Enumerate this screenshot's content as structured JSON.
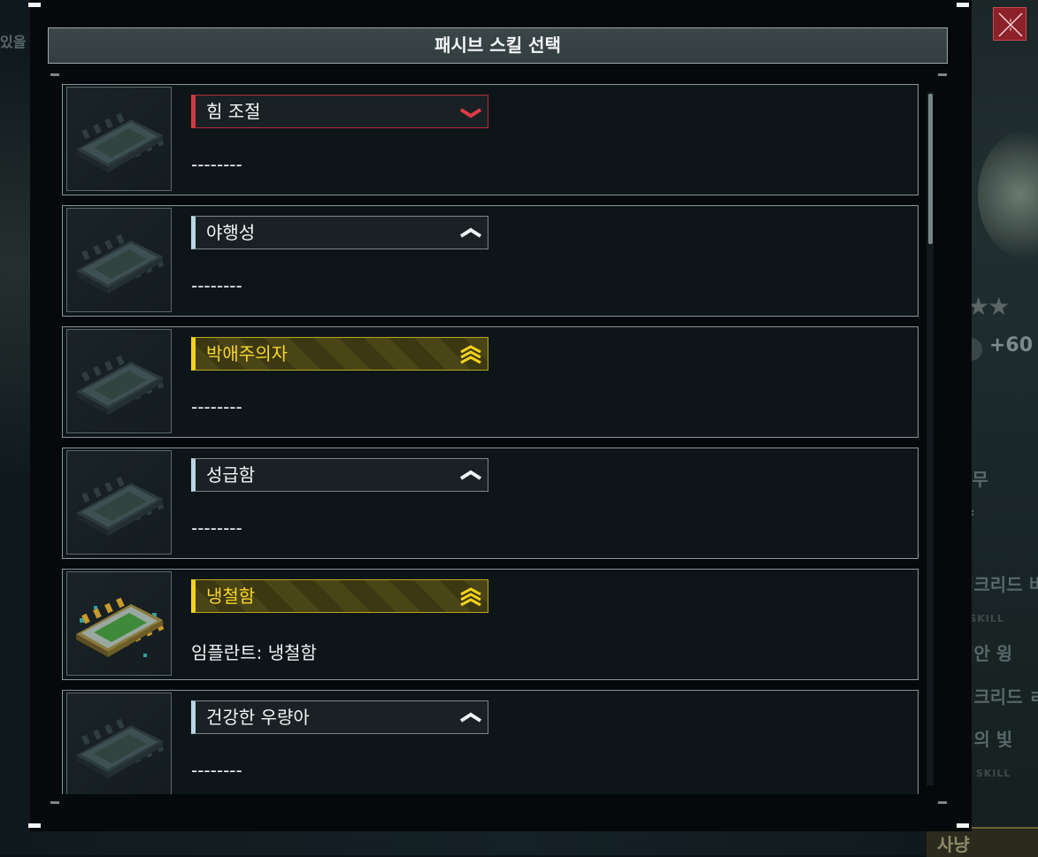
{
  "dialog": {
    "title": "패시브 스킬 선택",
    "close_icon": "close-x-icon"
  },
  "skills": [
    {
      "name": "힘 조절",
      "description": "--------",
      "rank": "down",
      "rank_icon": "chevron-down-icon",
      "style": "red",
      "chip": "chip-inactive-icon"
    },
    {
      "name": "야행성",
      "description": "--------",
      "rank": "up",
      "rank_icon": "chevron-up-icon",
      "style": "plain",
      "chip": "chip-inactive-icon"
    },
    {
      "name": "박애주의자",
      "description": "--------",
      "rank": "triple-up",
      "rank_icon": "triple-chevron-up-icon",
      "style": "gold",
      "chip": "chip-inactive-icon"
    },
    {
      "name": "성급함",
      "description": "--------",
      "rank": "up",
      "rank_icon": "chevron-up-icon",
      "style": "plain",
      "chip": "chip-inactive-icon"
    },
    {
      "name": "냉철함",
      "description": "임플란트: 냉철함",
      "rank": "triple-up",
      "rank_icon": "triple-chevron-up-icon",
      "style": "gold",
      "chip": "chip-active-icon"
    },
    {
      "name": "건강한 우량아",
      "description": "--------",
      "rank": "up",
      "rank_icon": "chevron-up-icon",
      "style": "plain",
      "chip": "chip-inactive-icon"
    }
  ],
  "background": {
    "left_text": "있을",
    "stars": "★★★",
    "bonus": "+60",
    "lines": [
      "임무",
      "량",
      "이크리드 비",
      "비안 윙",
      "이크리드 ㄹ",
      "희의 빛",
      "사냥"
    ],
    "small_labels": [
      "E SKILL",
      "VE SKILL"
    ]
  },
  "colors": {
    "gold": "#f3d21c",
    "red": "#d23a43",
    "plain_accent": "#b8d6e6",
    "close_bg": "#8c2129"
  }
}
